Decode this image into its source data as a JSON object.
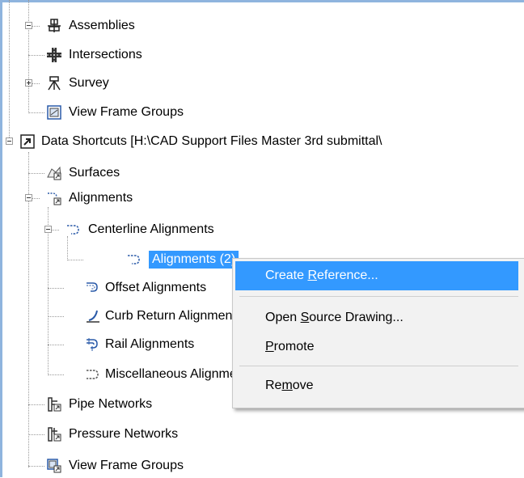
{
  "tree": {
    "items": [
      {
        "label": "Assemblies",
        "icon": "assemblies-icon"
      },
      {
        "label": "Intersections",
        "icon": "intersections-icon"
      },
      {
        "label": "Survey",
        "icon": "survey-icon"
      },
      {
        "label": "View Frame Groups",
        "icon": "view-frame-groups-icon"
      },
      {
        "label": "Data Shortcuts [H:\\CAD Support Files Master 3rd submittal\\",
        "icon": "shortcut-arrow-icon"
      },
      {
        "label": "Surfaces",
        "icon": "surfaces-icon"
      },
      {
        "label": "Alignments",
        "icon": "alignments-icon"
      },
      {
        "label": "Centerline Alignments",
        "icon": "centerline-alignment-icon"
      },
      {
        "label": "Alignments (2)",
        "icon": "alignment-icon",
        "selected": true
      },
      {
        "label": "Offset Alignments",
        "icon": "offset-alignment-icon"
      },
      {
        "label": "Curb Return Alignments",
        "icon": "curb-return-icon"
      },
      {
        "label": "Rail Alignments",
        "icon": "rail-alignment-icon"
      },
      {
        "label": "Miscellaneous Alignments",
        "icon": "misc-alignment-icon"
      },
      {
        "label": "Pipe Networks",
        "icon": "pipe-networks-icon"
      },
      {
        "label": "Pressure Networks",
        "icon": "pressure-networks-icon"
      },
      {
        "label": "View Frame Groups",
        "icon": "view-frame-groups-icon"
      }
    ]
  },
  "context_menu": {
    "create_reference": {
      "pre": "Create ",
      "key": "R",
      "post": "eference..."
    },
    "open_source": {
      "pre": "Open ",
      "key": "S",
      "post": "ource Drawing..."
    },
    "promote": {
      "pre": "",
      "key": "P",
      "post": "romote"
    },
    "remove": {
      "pre": "Re",
      "key": "m",
      "post": "ove"
    }
  },
  "colors": {
    "selection": "#3399ff",
    "menu_background": "#f2f2f2",
    "window_border": "#8fb4de"
  }
}
